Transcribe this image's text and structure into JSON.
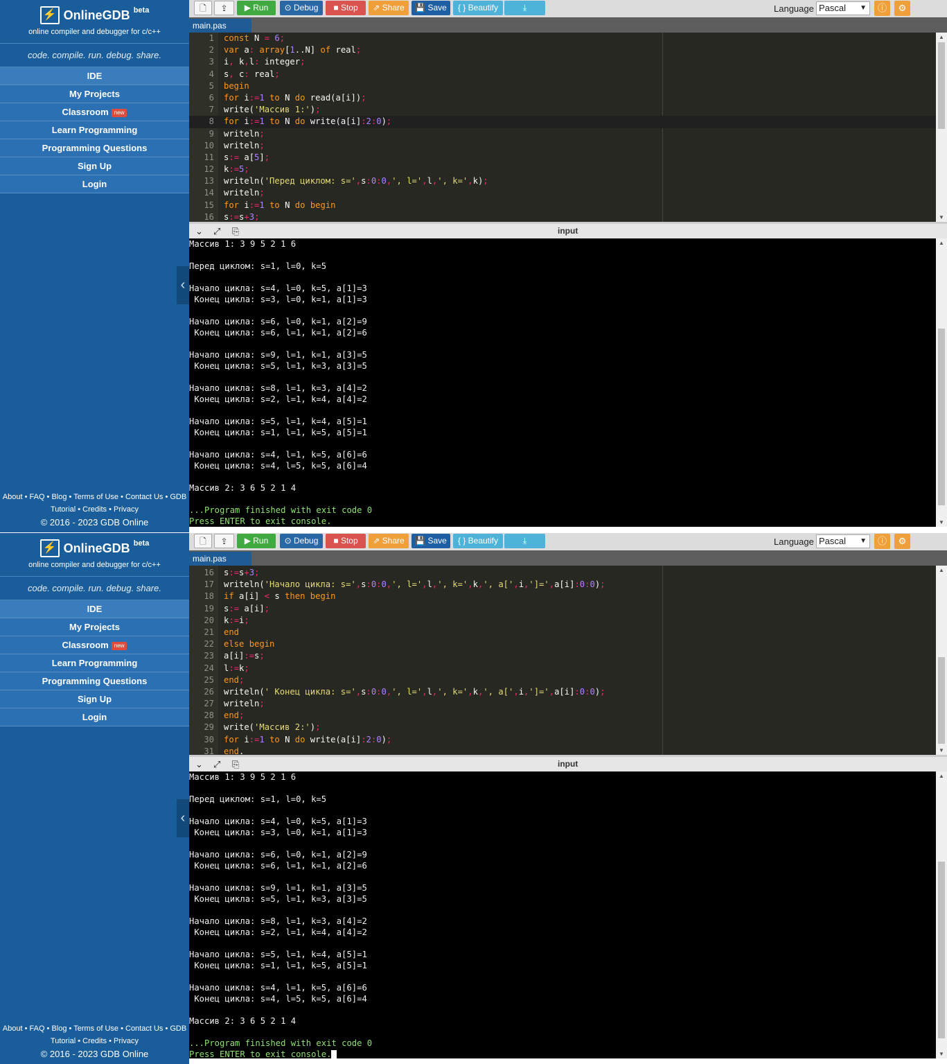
{
  "brand": {
    "name": "OnlineGDB",
    "beta": "beta",
    "subtitle": "online compiler and debugger for c/c++",
    "logo_glyph": "⚡"
  },
  "tagline": "code. compile. run. debug. share.",
  "nav": [
    {
      "label": "IDE"
    },
    {
      "label": "My Projects"
    },
    {
      "label": "Classroom",
      "badge": "new"
    },
    {
      "label": "Learn Programming"
    },
    {
      "label": "Programming Questions"
    },
    {
      "label": "Sign Up"
    },
    {
      "label": "Login"
    }
  ],
  "footer": {
    "line1": "About • FAQ • Blog • Terms of Use • Contact Us • GDB",
    "line2": "Tutorial • Credits • Privacy",
    "copyright": "© 2016 - 2023 GDB Online"
  },
  "toolbar": {
    "run": "Run",
    "debug": "Debug",
    "stop": "Stop",
    "share": "Share",
    "save": "Save",
    "beautify": "{ } Beautify",
    "language_label": "Language",
    "language_value": "Pascal"
  },
  "file_tab": "main.pas",
  "io_title": "input",
  "colors": {
    "sidebar": "#1a5d9b",
    "editor_bg": "#272822",
    "console_bg": "#000000",
    "exit_green": "#8ee26f"
  },
  "code": [
    "const N = 6;",
    "var a: array[1..N] of real;",
    "i, k,l: integer;",
    "s, c: real;",
    "begin",
    "for i:=1 to N do read(a[i]);",
    "write('Массив 1:');",
    "for i:=1 to N do write(a[i]:2:0);",
    "writeln;",
    "writeln;",
    "s:= a[5];",
    "k:=5;",
    "writeln('Перед циклом: s=',s:0:0,', l=',l,', k=',k);",
    "writeln;",
    "for i:=1 to N do begin",
    "s:=s+3;",
    "writeln('Начало цикла: s=',s:0:0,', l=',l,', k=',k,', a[',i,']=',a[i]:0:0);",
    "if a[i] < s then begin",
    "s:= a[i];",
    "k:=i;",
    "end",
    "else begin",
    "a[i]:=s;",
    "l:=k;",
    "end;",
    "writeln(' Конец цикла: s=',s:0:0,', l=',l,', k=',k,', a[',i,']=',a[i]:0:0);",
    "writeln;",
    "end;",
    "write('Массив 2:');",
    "for i:=1 to N do write(a[i]:2:0);",
    "end."
  ],
  "output": [
    "Массив 1: 3 9 5 2 1 6",
    "",
    "Перед циклом: s=1, l=0, k=5",
    "",
    "Начало цикла: s=4, l=0, k=5, a[1]=3",
    " Конец цикла: s=3, l=0, k=1, a[1]=3",
    "",
    "Начало цикла: s=6, l=0, k=1, a[2]=9",
    " Конец цикла: s=6, l=1, k=1, a[2]=6",
    "",
    "Начало цикла: s=9, l=1, k=1, a[3]=5",
    " Конец цикла: s=5, l=1, k=3, a[3]=5",
    "",
    "Начало цикла: s=8, l=1, k=3, a[4]=2",
    " Конец цикла: s=2, l=1, k=4, a[4]=2",
    "",
    "Начало цикла: s=5, l=1, k=4, a[5]=1",
    " Конец цикла: s=1, l=1, k=5, a[5]=1",
    "",
    "Начало цикла: s=4, l=1, k=5, a[6]=6",
    " Конец цикла: s=4, l=5, k=5, a[6]=4",
    "",
    "Массив 2: 3 6 5 2 1 4",
    ""
  ],
  "exit_lines": [
    "...Program finished with exit code 0",
    "Press ENTER to exit console."
  ],
  "screens": [
    {
      "first_line": 1,
      "last_line": 16,
      "current_line": 8
    },
    {
      "first_line": 16,
      "last_line": 31,
      "current_line": 0
    }
  ]
}
